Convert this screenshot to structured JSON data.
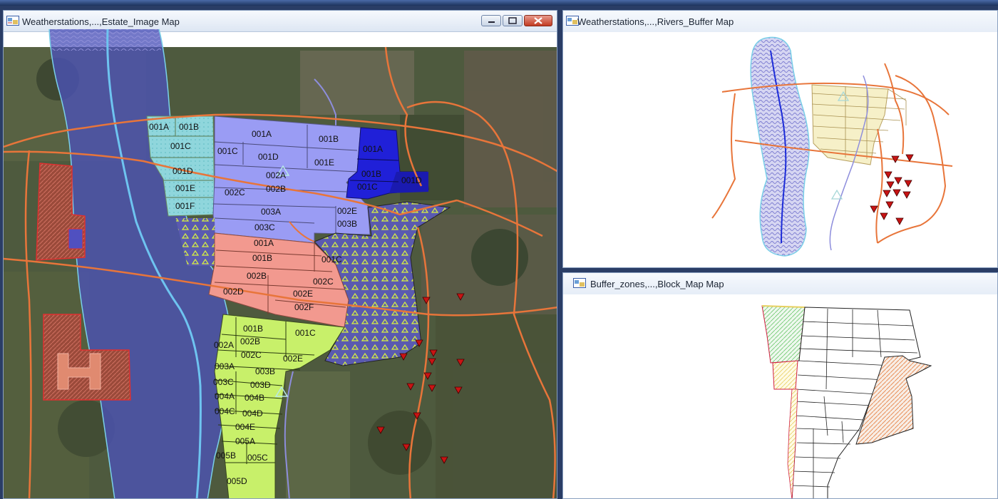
{
  "windows": {
    "estate": {
      "title": "Weatherstations,...,Estate_Image Map"
    },
    "rivers": {
      "title": "Weatherstations,...,Rivers_Buffer Map"
    },
    "block": {
      "title": "Buffer_zones,...,Block_Map Map"
    }
  },
  "block_labels": {
    "cyan": [
      "001A",
      "001B",
      "001C",
      "001D",
      "001E",
      "001F"
    ],
    "lavender": [
      "001A",
      "001B",
      "001C",
      "001D",
      "001E",
      "002A",
      "002C",
      "002B",
      "003A",
      "003C"
    ],
    "blue": [
      "001A",
      "001B",
      "001C",
      "001D"
    ],
    "blue_side": [
      "002E",
      "003B"
    ],
    "salmon": [
      "001A",
      "001B",
      "001C",
      "002B",
      "002C",
      "002D",
      "002E",
      "002F"
    ],
    "lime": [
      "001B",
      "001C",
      "002B",
      "002A",
      "002C",
      "002E",
      "003A",
      "003B",
      "003C",
      "003D",
      "004A",
      "004B",
      "004C",
      "004D",
      "004E",
      "005A",
      "005B",
      "005C",
      "005D"
    ]
  },
  "colors": {
    "river_buffer": "#4b52b8",
    "block_cyan": "#8fd6dc",
    "block_lavender": "#9a9cf4",
    "block_blue": "#2020d8",
    "block_salmon": "#f2998f",
    "block_lime": "#c8f06a",
    "road": "#e8753a",
    "station": "#c81414",
    "titlebar": "#e6edf7"
  },
  "icons": [
    "map-window-icon",
    "minimize-icon",
    "maximize-icon",
    "close-icon",
    "weather-station-icon"
  ]
}
